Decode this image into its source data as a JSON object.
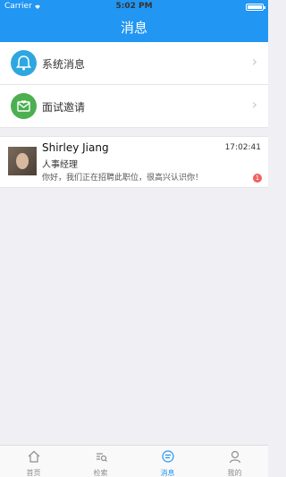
{
  "status": {
    "carrier": "Carrier",
    "time": "5:02 PM"
  },
  "header": {
    "title": "消息"
  },
  "system_items": [
    {
      "label": "系统消息",
      "icon": "bell-icon",
      "color": "#2ea7e0"
    },
    {
      "label": "面试邀请",
      "icon": "mail-heart-icon",
      "color": "#4caf50"
    }
  ],
  "message": {
    "name": "Shirley  Jiang",
    "role": "人事经理",
    "preview": "你好，我们正在招聘此职位，很高兴认识你！",
    "time": "17:02:41",
    "badge": "1"
  },
  "tabs": [
    {
      "label": "首页",
      "icon": "home-icon",
      "active": false
    },
    {
      "label": "检索",
      "icon": "search-list-icon",
      "active": false
    },
    {
      "label": "消息",
      "icon": "message-icon",
      "active": true
    },
    {
      "label": "我的",
      "icon": "user-icon",
      "active": false
    }
  ],
  "colors": {
    "primary": "#2196f3",
    "badge": "#f06060"
  }
}
